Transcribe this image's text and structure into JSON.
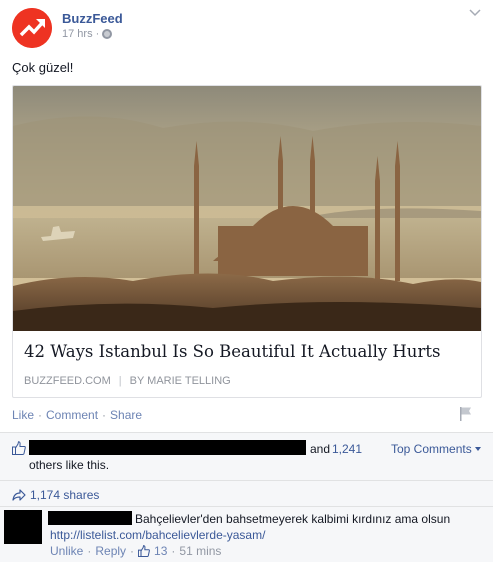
{
  "post": {
    "page_name": "BuzzFeed",
    "time": "17 hrs",
    "meta_sep": "·",
    "text": "Çok güzel!"
  },
  "link": {
    "title": "42 Ways Istanbul Is So Beautiful It Actually Hurts",
    "source": "BUZZFEED.COM",
    "separator": "|",
    "author": "BY MARIE TELLING"
  },
  "actions": {
    "like": "Like",
    "comment": "Comment",
    "share": "Share",
    "dot": "·"
  },
  "likes": {
    "and": "and",
    "count": "1,241",
    "others": "others like this.",
    "top_comments": "Top Comments"
  },
  "shares": {
    "label": "1,174 shares"
  },
  "comment": {
    "text": "Bahçelievler'den bahsetmeyerek kalbimi kırdınız ama olsun",
    "link": "http://listelist.com/bahcelievlerde-yasam/",
    "unlike": "Unlike",
    "reply": "Reply",
    "likes": "13",
    "time": "51 mins",
    "dot": "·"
  },
  "colors": {
    "brand_red": "#ee3322",
    "link_blue": "#3b5998",
    "muted": "#9197a3"
  },
  "icons": {
    "avatar": "buzzfeed-trending-arrow-icon",
    "privacy": "globe-icon",
    "menu": "chevron-down-icon",
    "report": "flag-icon",
    "like": "thumbs-up-icon",
    "share": "share-arrow-icon"
  }
}
